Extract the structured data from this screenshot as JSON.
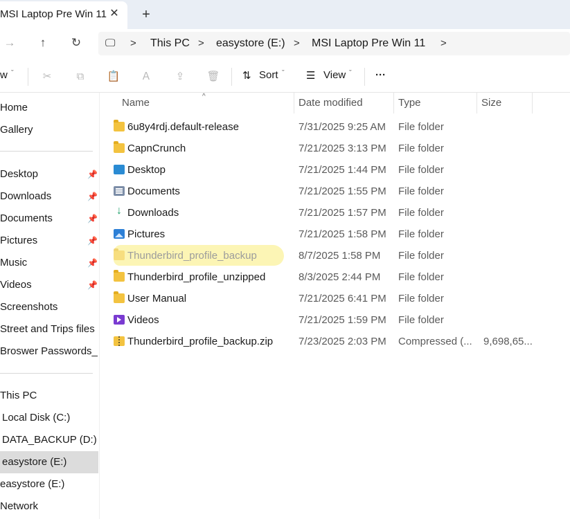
{
  "tab": {
    "title": "MSI Laptop Pre Win 11",
    "close_glyph": "✕",
    "new_tab_glyph": "+"
  },
  "nav": {
    "forward_glyph": "→",
    "up_glyph": "↑",
    "refresh_glyph": "↻",
    "pc_glyph": "🖵"
  },
  "breadcrumb": [
    "This PC",
    "easystore (E:)",
    "MSI Laptop Pre Win 11"
  ],
  "breadcrumb_sep": ">",
  "commandbar": {
    "new_label": "w",
    "new_caret": "ˇ",
    "cut_glyph": "✂",
    "copy_glyph": "⧉",
    "paste_glyph": "📋",
    "rename_glyph": "Ａ",
    "share_glyph": "⇪",
    "delete_glyph": "🗑",
    "sort_label": "Sort",
    "sort_glyph": "⇅",
    "view_label": "View",
    "view_glyph": "☰",
    "caret": "ˇ",
    "more_glyph": "···"
  },
  "sidebar": {
    "top": [
      "Home",
      "Gallery"
    ],
    "pinned": [
      "Desktop",
      "Downloads",
      "Documents",
      "Pictures",
      "Music",
      "Videos"
    ],
    "pin_glyph": "📌",
    "unpinned": [
      "Screenshots",
      "Street and Trips files",
      "Broswer Passwords_Bo"
    ],
    "drives": [
      "This PC",
      "Local Disk (C:)",
      "DATA_BACKUP (D:)",
      "easystore (E:)",
      "easystore (E:)",
      "Network"
    ],
    "selected_drive_index": 3
  },
  "columns": {
    "name": "Name",
    "date": "Date modified",
    "type": "Type",
    "size": "Size",
    "sort_glyph": "^"
  },
  "files": [
    {
      "name": "6u8y4rdj.default-release",
      "date": "7/31/2025 9:25 AM",
      "type": "File folder",
      "size": "",
      "icon": "folder-icon"
    },
    {
      "name": "CapnCrunch",
      "date": "7/21/2025 3:13 PM",
      "type": "File folder",
      "size": "",
      "icon": "folder-icon"
    },
    {
      "name": "Desktop",
      "date": "7/21/2025 1:44 PM",
      "type": "File folder",
      "size": "",
      "icon": "desktop-folder-icon"
    },
    {
      "name": "Documents",
      "date": "7/21/2025 1:55 PM",
      "type": "File folder",
      "size": "",
      "icon": "documents-folder-icon"
    },
    {
      "name": "Downloads",
      "date": "7/21/2025 1:57 PM",
      "type": "File folder",
      "size": "",
      "icon": "downloads-folder-icon"
    },
    {
      "name": "Pictures",
      "date": "7/21/2025 1:58 PM",
      "type": "File folder",
      "size": "",
      "icon": "pictures-folder-icon"
    },
    {
      "name": "Thunderbird_profile_backup",
      "date": "8/7/2025 1:58 PM",
      "type": "File folder",
      "size": "",
      "icon": "folder-icon"
    },
    {
      "name": "Thunderbird_profile_unzipped",
      "date": "8/3/2025 2:44 PM",
      "type": "File folder",
      "size": "",
      "icon": "folder-icon"
    },
    {
      "name": "User Manual",
      "date": "7/21/2025 6:41 PM",
      "type": "File folder",
      "size": "",
      "icon": "folder-icon"
    },
    {
      "name": "Videos",
      "date": "7/21/2025 1:59 PM",
      "type": "File folder",
      "size": "",
      "icon": "videos-folder-icon"
    },
    {
      "name": "Thunderbird_profile_backup.zip",
      "date": "7/23/2025 2:03 PM",
      "type": "Compressed (...",
      "size": "9,698,65...",
      "icon": "zip-file-icon"
    }
  ],
  "highlight_color": "#fbf3a8"
}
